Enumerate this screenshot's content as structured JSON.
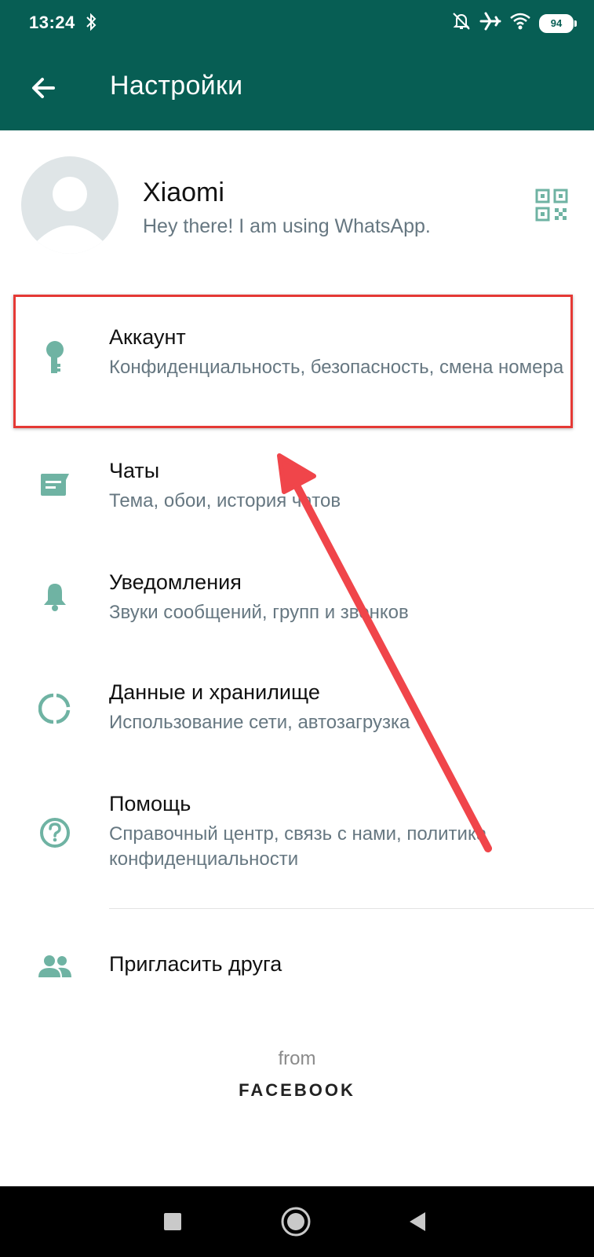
{
  "status_bar": {
    "time": "13:24",
    "battery": "94",
    "icons": [
      "bluetooth-icon",
      "mute-icon",
      "airplane-icon",
      "wifi-icon",
      "battery-icon"
    ]
  },
  "header": {
    "title": "Настройки",
    "back_icon": "arrow-back-icon"
  },
  "profile": {
    "name": "Xiaomi",
    "status": "Hey there! I am using WhatsApp.",
    "qr_icon": "qr-code-icon"
  },
  "settings": [
    {
      "icon": "key-icon",
      "title": "Аккаунт",
      "subtitle": "Конфиденциальность, безопасность, смена номера"
    },
    {
      "icon": "chat-icon",
      "title": "Чаты",
      "subtitle": "Тема, обои, история чатов"
    },
    {
      "icon": "bell-icon",
      "title": "Уведомления",
      "subtitle": "Звуки сообщений, групп и звонков"
    },
    {
      "icon": "data-usage-icon",
      "title": "Данные и хранилище",
      "subtitle": "Использование сети, автозагрузка"
    },
    {
      "icon": "help-icon",
      "title": "Помощь",
      "subtitle": "Справочный центр, связь с нами, политика конфиденциальности"
    }
  ],
  "invite": {
    "icon": "people-icon",
    "label": "Пригласить друга"
  },
  "footer": {
    "from": "from",
    "brand": "FACEBOOK"
  },
  "colors": {
    "header": "#075e54",
    "icon_accent": "#6fb3a3",
    "highlight": "#e53935",
    "annotation_arrow": "#f0454a"
  }
}
